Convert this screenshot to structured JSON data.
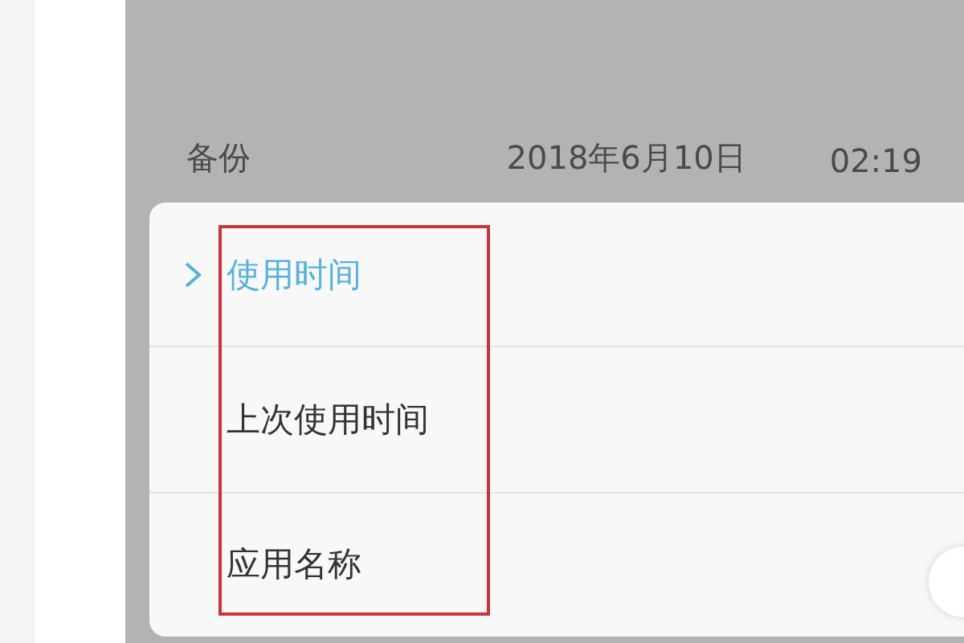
{
  "backup_row": {
    "label": "备份",
    "date": "2018年6月10日",
    "time": "02:19"
  },
  "sort_menu": {
    "items": [
      {
        "label": "使用时间",
        "selected": true
      },
      {
        "label": "上次使用时间",
        "selected": false
      },
      {
        "label": "应用名称",
        "selected": false
      }
    ]
  }
}
